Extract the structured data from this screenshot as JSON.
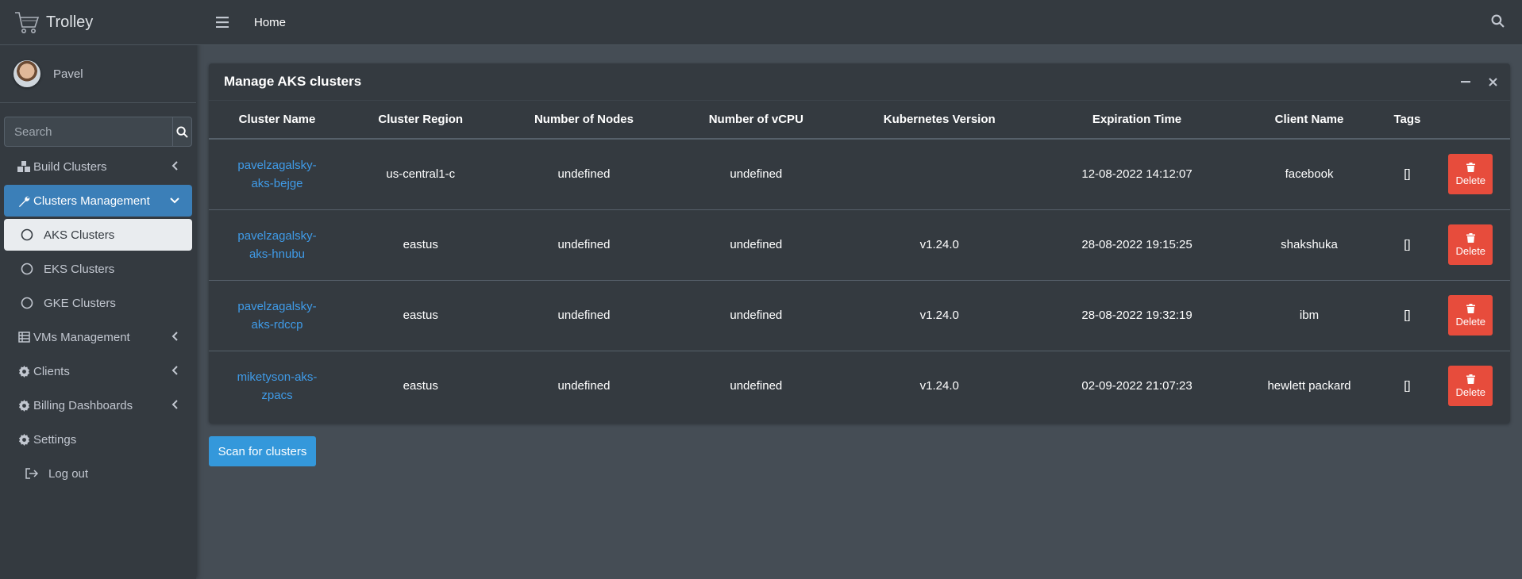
{
  "brand": {
    "name": "Trolley"
  },
  "user": {
    "name": "Pavel"
  },
  "sidebar": {
    "search_placeholder": "Search",
    "items": [
      {
        "label": "Build Clusters"
      },
      {
        "label": "Clusters Management"
      },
      {
        "label": "AKS Clusters"
      },
      {
        "label": "EKS Clusters"
      },
      {
        "label": "GKE Clusters"
      },
      {
        "label": "VMs Management"
      },
      {
        "label": "Clients"
      },
      {
        "label": "Billing Dashboards"
      },
      {
        "label": "Settings"
      },
      {
        "label": "Log out"
      }
    ]
  },
  "topbar": {
    "home_label": "Home"
  },
  "card": {
    "title": "Manage AKS clusters",
    "columns": [
      "Cluster Name",
      "Cluster Region",
      "Number of Nodes",
      "Number of vCPU",
      "Kubernetes Version",
      "Expiration Time",
      "Client Name",
      "Tags"
    ],
    "rows": [
      {
        "name": "pavelzagalsky-aks-bejge",
        "region": "us-central1-c",
        "nodes": "undefined",
        "vcpu": "undefined",
        "version": "",
        "expiration": "12-08-2022 14:12:07",
        "client": "facebook",
        "tags": "[]",
        "delete_label": "Delete"
      },
      {
        "name": "pavelzagalsky-aks-hnubu",
        "region": "eastus",
        "nodes": "undefined",
        "vcpu": "undefined",
        "version": "v1.24.0",
        "expiration": "28-08-2022 19:15:25",
        "client": "shakshuka",
        "tags": "[]",
        "delete_label": "Delete"
      },
      {
        "name": "pavelzagalsky-aks-rdccp",
        "region": "eastus",
        "nodes": "undefined",
        "vcpu": "undefined",
        "version": "v1.24.0",
        "expiration": "28-08-2022 19:32:19",
        "client": "ibm",
        "tags": "[]",
        "delete_label": "Delete"
      },
      {
        "name": "miketyson-aks-zpacs",
        "region": "eastus",
        "nodes": "undefined",
        "vcpu": "undefined",
        "version": "v1.24.0",
        "expiration": "02-09-2022 21:07:23",
        "client": "hewlett packard",
        "tags": "[]",
        "delete_label": "Delete"
      }
    ]
  },
  "scan_button": "Scan for clusters",
  "colors": {
    "accent": "#3498db",
    "danger": "#e74c3c",
    "link": "#3f9be8",
    "sidebar_bg": "#343a40",
    "content_bg": "#454d55"
  }
}
